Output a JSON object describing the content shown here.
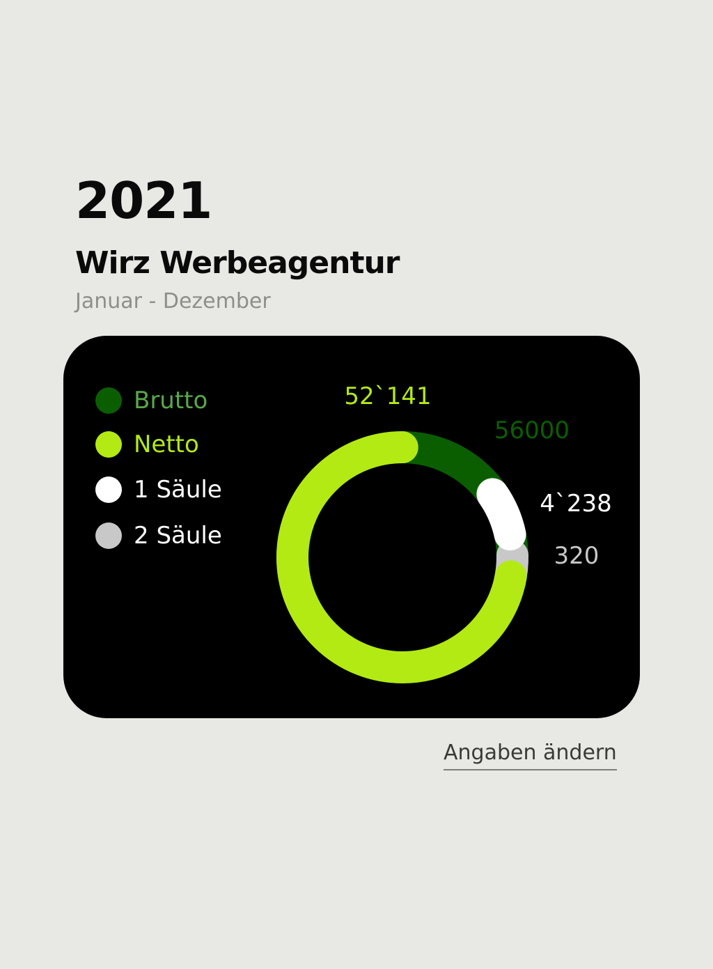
{
  "header": {
    "year": "2021",
    "company": "Wirz Werbeagentur",
    "period": "Januar - Dezember"
  },
  "chart_data": {
    "type": "pie",
    "style": "donut",
    "total": 56000,
    "series": [
      {
        "name": "Brutto",
        "value": 56000,
        "display": "56000",
        "color": "#0b5e00",
        "legend_color": "#58a84a"
      },
      {
        "name": "Netto",
        "value": 52141,
        "display": "52`141",
        "color": "#b3ea14",
        "legend_color": "#b3ea14"
      },
      {
        "name": "1 Säule",
        "value": 4238,
        "display": "4`238",
        "color": "#ffffff",
        "legend_color": "#ffffff"
      },
      {
        "name": "2 Säule",
        "value": 320,
        "display": "320",
        "color": "#c8c8c8",
        "legend_color": "#c8c8c8"
      }
    ]
  },
  "actions": {
    "edit_label": "Angaben ändern"
  }
}
